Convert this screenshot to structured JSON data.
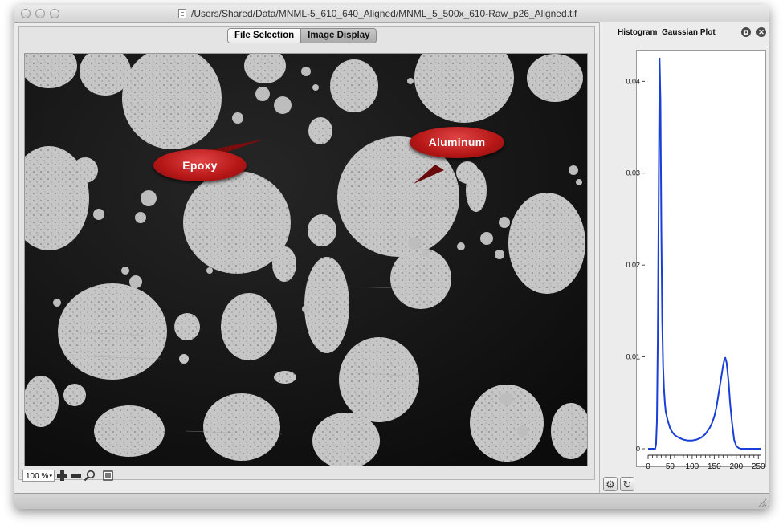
{
  "window": {
    "title": "/Users/Shared/Data/MNML-5_610_640_Aligned/MNML_5_500x_610-Raw_p26_Aligned.tif"
  },
  "tabs": {
    "file_selection": "File Selection",
    "image_display": "Image Display",
    "active": "Image Display"
  },
  "callouts": {
    "epoxy": "Epoxy",
    "aluminum": "Aluminum"
  },
  "toolbar": {
    "zoom_value": "100 %",
    "icons": [
      "zoom-in-icon",
      "zoom-out-icon",
      "magnifier-icon",
      "fit-window-icon"
    ]
  },
  "right_panel": {
    "title_histogram": "Histogram",
    "title_gaussian": "Gaussian Plot",
    "icons": [
      "detach-icon",
      "close-icon",
      "gear-icon",
      "refresh-icon"
    ]
  },
  "chart_data": {
    "type": "line",
    "title": "",
    "xlabel": "",
    "ylabel": "",
    "xlim": [
      0,
      255
    ],
    "ylim": [
      0,
      0.043
    ],
    "x_ticks": [
      "0",
      "50",
      "100",
      "150",
      "200",
      "250"
    ],
    "y_ticks": [
      "0",
      "0.01",
      "0.02",
      "0.03",
      "0.04"
    ],
    "color": "#1a3fd6",
    "series": [
      {
        "x": [
          0,
          16,
          18,
          20,
          22,
          24,
          26,
          28,
          30,
          32,
          34,
          36,
          38,
          40,
          45,
          50,
          55,
          60,
          70,
          80,
          90,
          100,
          110,
          120,
          130,
          140,
          145,
          150,
          155,
          160,
          165,
          170,
          173,
          175,
          178,
          180,
          183,
          186,
          190,
          195,
          200,
          205,
          210,
          255
        ],
        "y": [
          0,
          0,
          0.0005,
          0.003,
          0.012,
          0.027,
          0.0425,
          0.038,
          0.024,
          0.014,
          0.009,
          0.0065,
          0.005,
          0.004,
          0.003,
          0.0022,
          0.0018,
          0.0015,
          0.0012,
          0.001,
          0.0009,
          0.0009,
          0.001,
          0.0012,
          0.0016,
          0.0023,
          0.0028,
          0.0035,
          0.0045,
          0.006,
          0.0075,
          0.009,
          0.0097,
          0.0099,
          0.0094,
          0.0085,
          0.007,
          0.005,
          0.003,
          0.001,
          0.0003,
          0.0001,
          0.0,
          0.0
        ]
      }
    ]
  }
}
